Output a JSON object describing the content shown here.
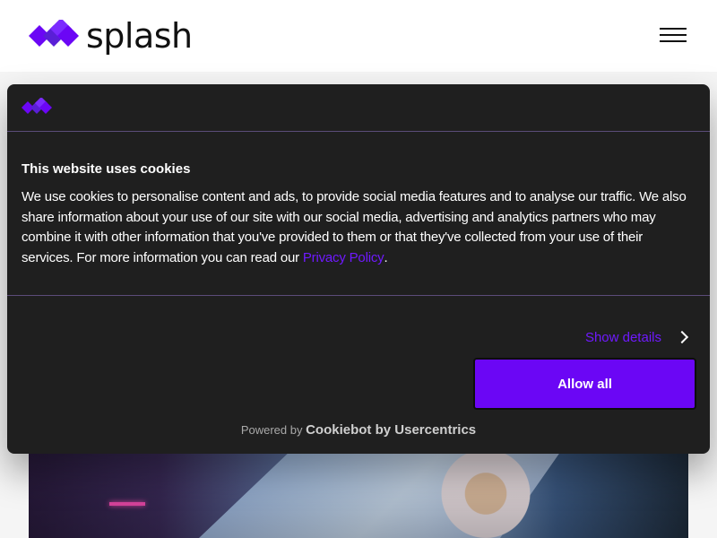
{
  "header": {
    "logo_text": "splash",
    "menu_icon": "hamburger-menu-icon"
  },
  "colors": {
    "brand_purple": "#6b06f5",
    "link_purple": "#6f19ff",
    "dialog_bg": "#1f1f1f",
    "divider": "#5b4c79"
  },
  "cookie_dialog": {
    "title": "This website uses cookies",
    "text_before_link": "We use cookies to personalise content and ads, to provide social media features and to analyse our traffic. We also share information about your use of our site with our social media, advertising and analytics partners who may combine it with other information that you've provided to them or that they've collected from your use of their services. For more information you can read our ",
    "privacy_link": "Privacy Policy",
    "text_after_link": ".",
    "show_details": "Show details",
    "allow_all": "Allow all",
    "powered_by_prefix": "Powered by ",
    "powered_by_brand": "Cookiebot by Usercentrics"
  }
}
